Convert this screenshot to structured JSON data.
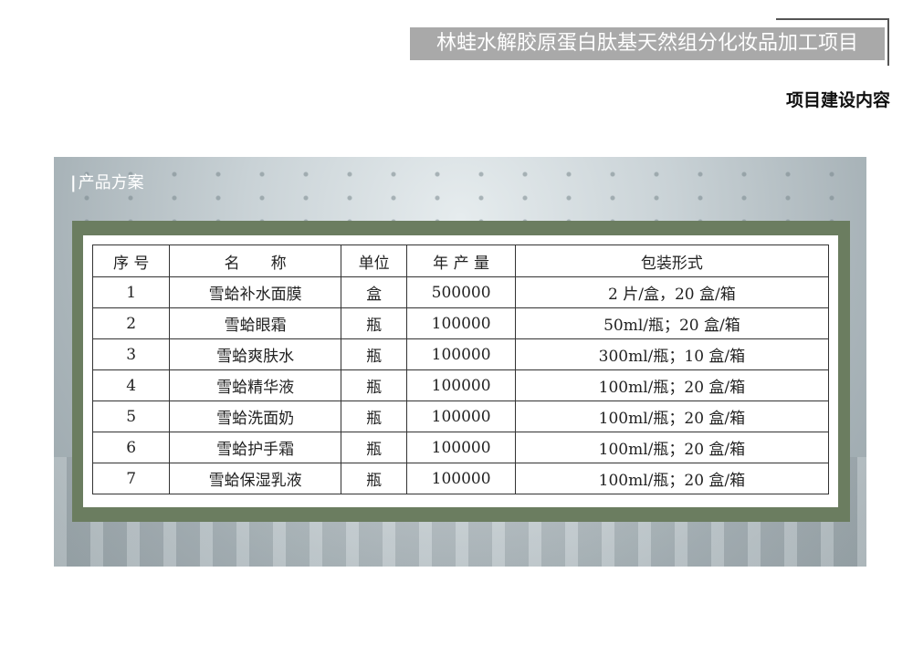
{
  "header": {
    "project_title": "林蛙水解胶原蛋白肽基天然组分化妆品加工项目",
    "section_title": "项目建设内容"
  },
  "panel": {
    "label": "产品方案"
  },
  "table": {
    "headers": [
      "序 号",
      "名　　称",
      "单位",
      "年 产 量",
      "包装形式"
    ],
    "rows": [
      [
        "1",
        "雪蛤补水面膜",
        "盒",
        "500000",
        "2 片/盒，20 盒/箱"
      ],
      [
        "2",
        "雪蛤眼霜",
        "瓶",
        "100000",
        "50ml/瓶；20 盒/箱"
      ],
      [
        "3",
        "雪蛤爽肤水",
        "瓶",
        "100000",
        "300ml/瓶；10 盒/箱"
      ],
      [
        "4",
        "雪蛤精华液",
        "瓶",
        "100000",
        "100ml/瓶；20 盒/箱"
      ],
      [
        "5",
        "雪蛤洗面奶",
        "瓶",
        "100000",
        "100ml/瓶；20 盒/箱"
      ],
      [
        "6",
        "雪蛤护手霜",
        "瓶",
        "100000",
        "100ml/瓶；20 盒/箱"
      ],
      [
        "7",
        "雪蛤保湿乳液",
        "瓶",
        "100000",
        "100ml/瓶；20 盒/箱"
      ]
    ]
  },
  "colors": {
    "title_bg": "#a9a9a9",
    "frame_green": "#6b7d60"
  }
}
